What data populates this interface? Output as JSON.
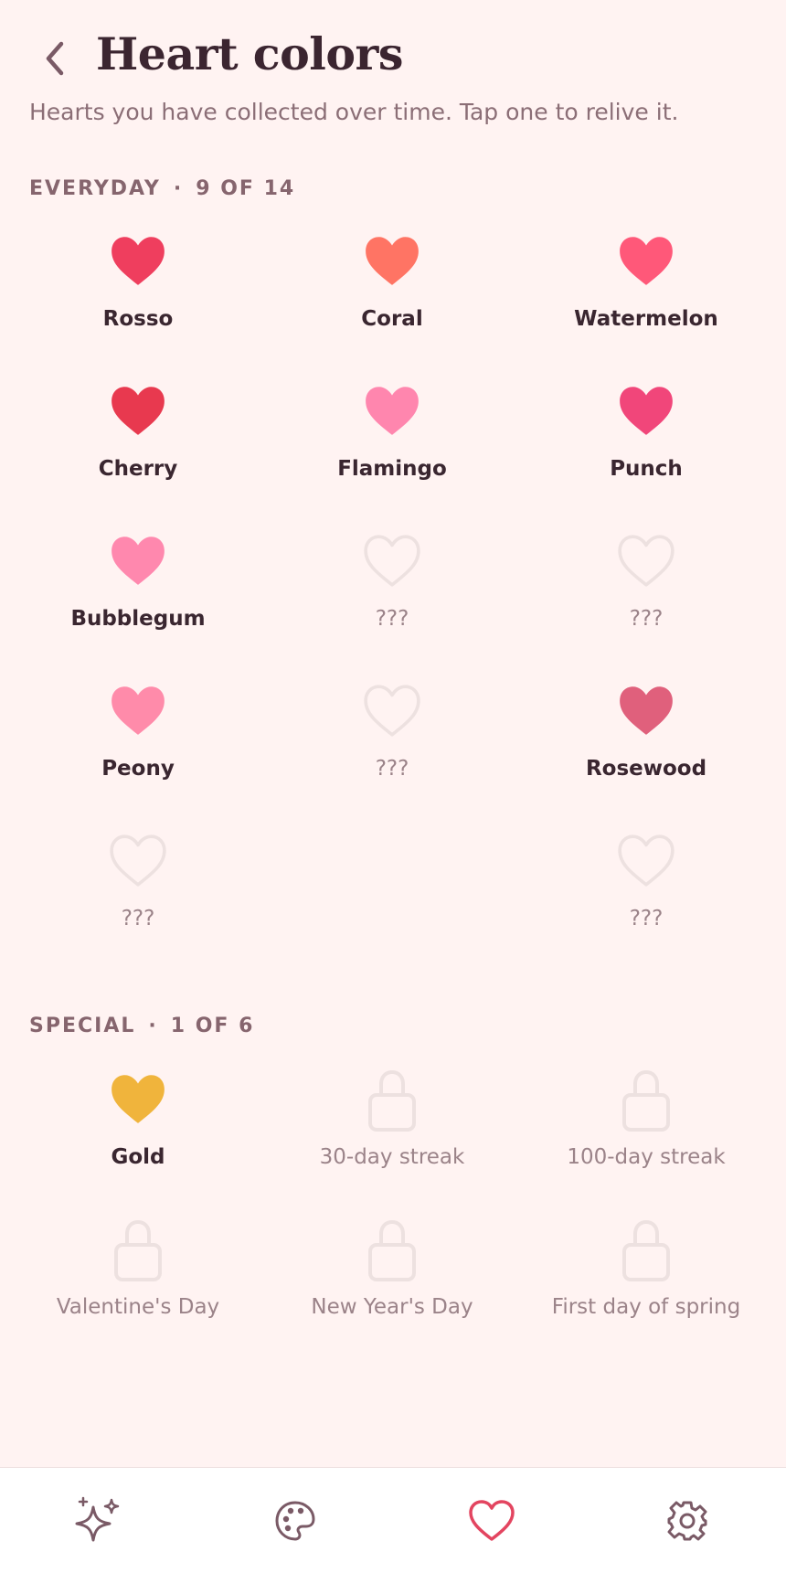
{
  "header": {
    "title": "Heart colors",
    "subtitle": "Hearts you have collected over time. Tap one to relive it."
  },
  "sections": {
    "everyday": {
      "label": "EVERYDAY",
      "count": "9 OF 14",
      "items": [
        {
          "name": "Rosso",
          "color": "#ef3e5e",
          "unlocked": true
        },
        {
          "name": "Coral",
          "color": "#ff7464",
          "unlocked": true
        },
        {
          "name": "Watermelon",
          "color": "#ff5879",
          "unlocked": true
        },
        {
          "name": "Cherry",
          "color": "#e8394f",
          "unlocked": true
        },
        {
          "name": "Flamingo",
          "color": "#ff86ae",
          "unlocked": true
        },
        {
          "name": "Punch",
          "color": "#f1467a",
          "unlocked": true
        },
        {
          "name": "Bubblegum",
          "color": "#ff88ae",
          "unlocked": true
        },
        {
          "name": "???",
          "color": "#ede1e0",
          "unlocked": false
        },
        {
          "name": "???",
          "color": "#ede1e0",
          "unlocked": false
        },
        {
          "name": "Peony",
          "color": "#ff8baa",
          "unlocked": true
        },
        {
          "name": "???",
          "color": "#ede1e0",
          "unlocked": false
        },
        {
          "name": "Rosewood",
          "color": "#e0607c",
          "unlocked": true
        },
        {
          "name": "???",
          "color": "#ede1e0",
          "unlocked": false
        },
        {
          "name": "???",
          "color": "#ede1e0",
          "unlocked": false
        }
      ]
    },
    "special": {
      "label": "SPECIAL",
      "count": "1 OF 6",
      "items": [
        {
          "name": "Gold",
          "color": "#f0b43c",
          "unlocked": true
        },
        {
          "name": "30-day streak",
          "color": "#ede1e0",
          "unlocked": false
        },
        {
          "name": "100-day streak",
          "color": "#ede1e0",
          "unlocked": false
        },
        {
          "name": "Valentine's Day",
          "color": "#ede1e0",
          "unlocked": false
        },
        {
          "name": "New Year's Day",
          "color": "#ede1e0",
          "unlocked": false
        },
        {
          "name": "First day of spring",
          "color": "#ede1e0",
          "unlocked": false
        }
      ]
    }
  },
  "nav": {
    "items": [
      {
        "icon": "sparkles-icon",
        "active": false
      },
      {
        "icon": "palette-icon",
        "active": false
      },
      {
        "icon": "heart-icon",
        "active": true
      },
      {
        "icon": "settings-gear-icon",
        "active": false
      }
    ],
    "active_color": "#e34560",
    "inactive_color": "#7a5a66"
  }
}
